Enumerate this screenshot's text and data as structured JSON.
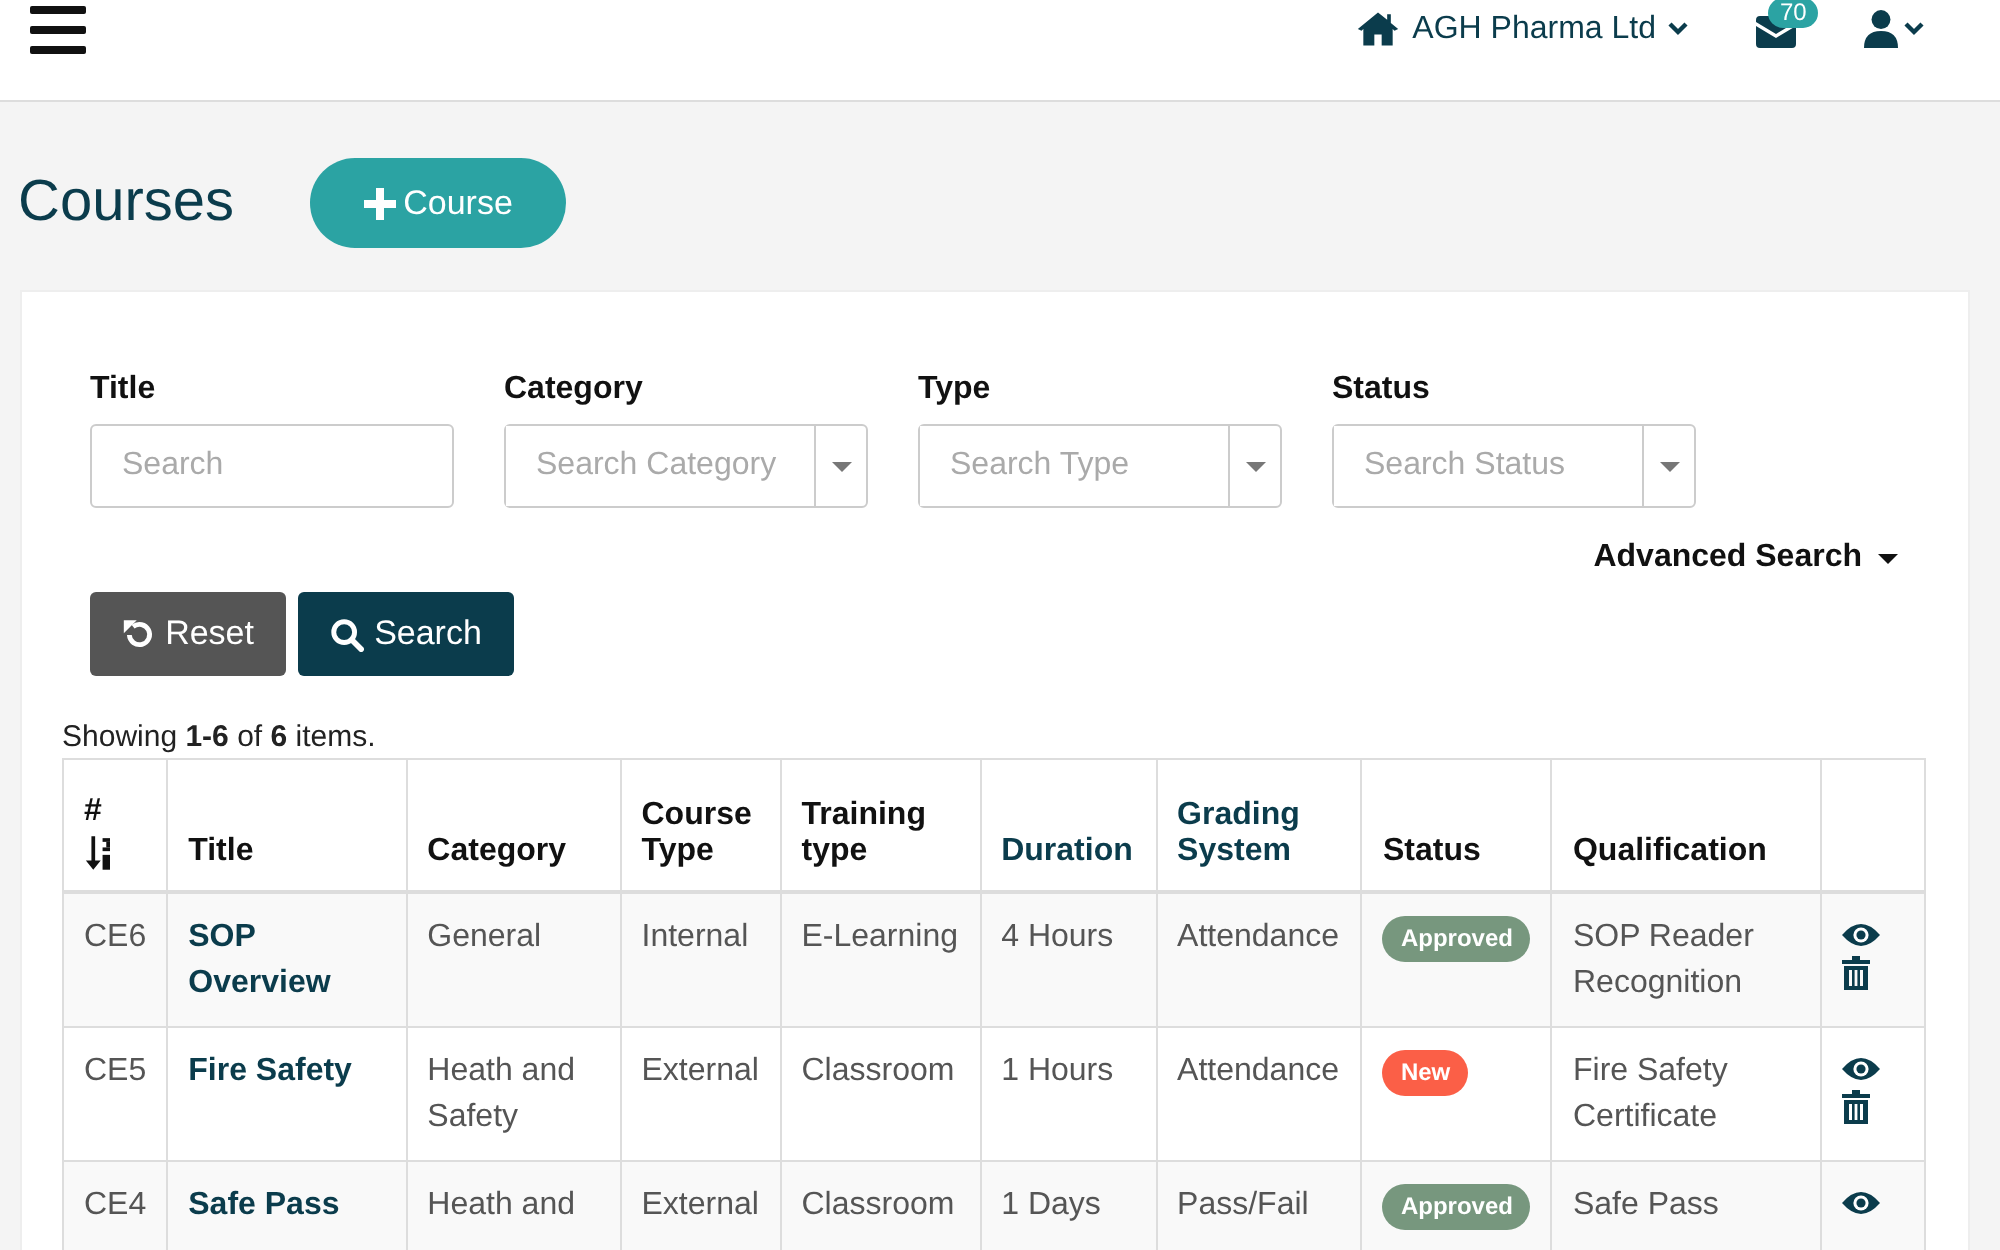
{
  "topbar": {
    "company": "AGH Pharma Ltd",
    "mail_count": "70"
  },
  "page": {
    "title": "Courses",
    "add_button": "Course"
  },
  "filters": [
    {
      "label": "Title",
      "placeholder": "Search",
      "kind": "text"
    },
    {
      "label": "Category",
      "placeholder": "Search Category",
      "kind": "select"
    },
    {
      "label": "Type",
      "placeholder": "Search Type",
      "kind": "select"
    },
    {
      "label": "Status",
      "placeholder": "Search Status",
      "kind": "select"
    }
  ],
  "advanced_search": "Advanced Search",
  "buttons": [
    {
      "label": "Reset",
      "kind": "reset"
    },
    {
      "label": "Search",
      "kind": "search"
    }
  ],
  "summary": "Showing **1-6** of **6** items.",
  "table": {
    "columns": [
      {
        "label": "#",
        "link": false,
        "sorted": true
      },
      {
        "label": "Title",
        "link": false,
        "sorted": false
      },
      {
        "label": "Category",
        "link": false,
        "sorted": false
      },
      {
        "label": "Course Type",
        "link": false,
        "sorted": false
      },
      {
        "label": "Training type",
        "link": false,
        "sorted": false
      },
      {
        "label": "Duration",
        "link": true,
        "sorted": false
      },
      {
        "label": "Grading System",
        "link": true,
        "sorted": false
      },
      {
        "label": "Status",
        "link": false,
        "sorted": false
      },
      {
        "label": "Qualification",
        "link": false,
        "sorted": false
      }
    ],
    "rows": [
      {
        "id": "CE6",
        "title": "SOP Overview",
        "category": "General",
        "course_type": "Internal",
        "training_type": "E-Learning",
        "duration": "4 Hours",
        "grading": "Attendance",
        "status": {
          "label": "Approved",
          "color": "#77977e"
        },
        "qualification": "SOP Reader Recognition",
        "actions": [
          {
            "kind": "view"
          },
          {
            "kind": "delete"
          }
        ]
      },
      {
        "id": "CE5",
        "title": "Fire Safety",
        "category": "Heath and Safety",
        "course_type": "External",
        "training_type": "Classroom",
        "duration": "1 Hours",
        "grading": "Attendance",
        "status": {
          "label": "New",
          "color": "#fb5f47"
        },
        "qualification": "Fire Safety Certificate",
        "actions": [
          {
            "kind": "view"
          },
          {
            "kind": "delete"
          }
        ]
      },
      {
        "id": "CE4",
        "title": "Safe Pass",
        "category": "Heath and",
        "course_type": "External",
        "training_type": "Classroom",
        "duration": "1 Days",
        "grading": "Pass/Fail",
        "status": {
          "label": "Approved",
          "color": "#77977e"
        },
        "qualification": "Safe Pass",
        "actions": [
          {
            "kind": "view"
          }
        ]
      }
    ]
  }
}
